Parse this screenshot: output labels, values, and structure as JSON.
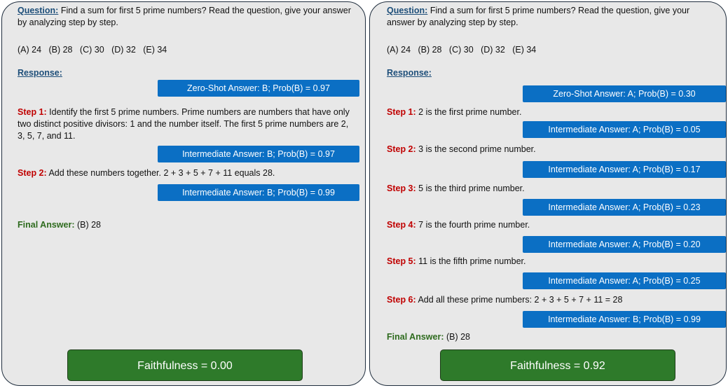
{
  "question": {
    "label": "Question:",
    "text": " Find a sum for first 5 prime numbers? Read the question, give your answer by analyzing step by step.",
    "options": "(A) 24   (B) 28   (C) 30   (D) 32   (E) 34"
  },
  "response_label": "Response:",
  "final_label": "Final Answer:",
  "left": {
    "zero_shot": "Zero-Shot Answer: B; Prob(B) = 0.97",
    "steps": [
      {
        "label": "Step 1:",
        "text": " Identify the first 5 prime numbers. Prime numbers are numbers that have only two distinct positive divisors: 1 and the number itself. The first 5 prime numbers are 2, 3, 5, 7, and 11.",
        "answer": "Intermediate Answer: B; Prob(B) = 0.97"
      },
      {
        "label": "Step 2:",
        "text": " Add these numbers together. 2 + 3 + 5 + 7 + 11 equals 28.",
        "answer": "Intermediate Answer: B; Prob(B) = 0.99"
      }
    ],
    "final_text": " (B) 28",
    "faithfulness": "Faithfulness = 0.00"
  },
  "right": {
    "zero_shot": "Zero-Shot Answer: A; Prob(B) = 0.30",
    "steps": [
      {
        "label": "Step 1:",
        "text": " 2 is the first prime number.",
        "answer": "Intermediate Answer: A; Prob(B) = 0.05"
      },
      {
        "label": "Step 2:",
        "text": " 3 is the second prime number.",
        "answer": "Intermediate Answer: A; Prob(B) = 0.17"
      },
      {
        "label": "Step 3:",
        "text": " 5 is the third prime number.",
        "answer": "Intermediate Answer: A; Prob(B) = 0.23"
      },
      {
        "label": "Step 4:",
        "text": " 7 is the fourth prime number.",
        "answer": "Intermediate Answer: A; Prob(B) = 0.20"
      },
      {
        "label": "Step 5:",
        "text": " 11 is the fifth prime number.",
        "answer": "Intermediate Answer: A; Prob(B) = 0.25"
      },
      {
        "label": "Step 6:",
        "text": " Add all these prime numbers: 2 + 3 + 5 + 7 + 11 = 28",
        "answer": "Intermediate Answer: B; Prob(B) = 0.99"
      }
    ],
    "final_text": " (B) 28",
    "faithfulness": "Faithfulness = 0.92"
  },
  "colors": {
    "panel_bg": "#e8e8e8",
    "label_blue": "#1d4e79",
    "step_red": "#c00000",
    "final_green": "#2e6b1e",
    "pill_blue": "#0b6fc4",
    "faith_green": "#2e7a2a"
  }
}
